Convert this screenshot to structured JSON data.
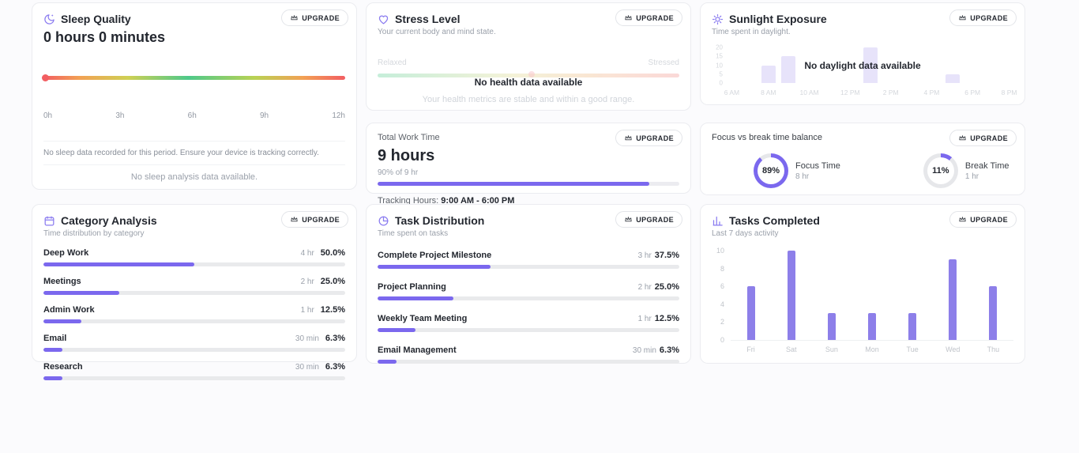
{
  "colors": {
    "accent": "#7b68ee",
    "track": "#e6e7ea"
  },
  "upgrade_label": "UPGRADE",
  "cards": {
    "sleep": {
      "title": "Sleep Quality",
      "value": "0 hours 0 minutes",
      "ticks": [
        "0h",
        "3h",
        "6h",
        "9h",
        "12h"
      ],
      "note": "No sleep data recorded for this period. Ensure your device is tracking correctly.",
      "empty": "No sleep analysis data available."
    },
    "stress": {
      "title": "Stress Level",
      "subtitle": "Your current body and mind state.",
      "scale_left": "Relaxed",
      "scale_right": "Stressed",
      "overlay_title": "No health data available",
      "overlay_subtitle": "Your health metrics are stable and within a good range."
    },
    "sunlight": {
      "title": "Sunlight Exposure",
      "subtitle": "Time spent in daylight.",
      "overlay_title": "No daylight data available"
    },
    "work": {
      "title": "Total Work Time",
      "value": "9 hours",
      "progress_caption": "90% of 9 hr",
      "progress_pct": 90,
      "tracking_label": "Tracking Hours:",
      "tracking_value": "9:00 AM - 6:00 PM"
    },
    "focus": {
      "title": "Focus vs break time balance",
      "donuts": [
        {
          "pct": 89,
          "pct_label": "89%",
          "label": "Focus Time",
          "sub": "8 hr"
        },
        {
          "pct": 11,
          "pct_label": "11%",
          "label": "Break Time",
          "sub": "1 hr"
        }
      ]
    },
    "category": {
      "title": "Category Analysis",
      "subtitle": "Time distribution by category",
      "rows": [
        {
          "label": "Deep Work",
          "time": "4 hr",
          "pct_label": "50.0%",
          "pct": 50
        },
        {
          "label": "Meetings",
          "time": "2 hr",
          "pct_label": "25.0%",
          "pct": 25
        },
        {
          "label": "Admin Work",
          "time": "1 hr",
          "pct_label": "12.5%",
          "pct": 12.5
        },
        {
          "label": "Email",
          "time": "30 min",
          "pct_label": "6.3%",
          "pct": 6.3
        },
        {
          "label": "Research",
          "time": "30 min",
          "pct_label": "6.3%",
          "pct": 6.3
        }
      ]
    },
    "tasks_dist": {
      "title": "Task Distribution",
      "subtitle": "Time spent on tasks",
      "rows": [
        {
          "label": "Complete Project Milestone",
          "time": "3 hr",
          "pct_label": "37.5%",
          "pct": 37.5
        },
        {
          "label": "Project Planning",
          "time": "2 hr",
          "pct_label": "25.0%",
          "pct": 25
        },
        {
          "label": "Weekly Team Meeting",
          "time": "1 hr",
          "pct_label": "12.5%",
          "pct": 12.5
        },
        {
          "label": "Email Management",
          "time": "30 min",
          "pct_label": "6.3%",
          "pct": 6.3
        }
      ]
    },
    "tasks_done": {
      "title": "Tasks Completed",
      "subtitle": "Last 7 days activity"
    }
  },
  "chart_data": [
    {
      "type": "bar",
      "title": "Sunlight Exposure",
      "ylim": [
        0,
        20
      ],
      "yticks": [
        "20",
        "15",
        "10",
        "5",
        "0"
      ],
      "ytick_pos": [
        0,
        25,
        50,
        75,
        100
      ],
      "xticks": [
        "6 AM",
        "8 AM",
        "10 AM",
        "12 PM",
        "2 PM",
        "4 PM",
        "6 PM",
        "8 PM"
      ],
      "xtick_pos": [
        1.5,
        14.3,
        28.6,
        42.9,
        57.1,
        71.4,
        85.7,
        98.5
      ],
      "bars": [
        {
          "x": "8 AM",
          "value": 10,
          "left_pct": 14.3,
          "height_pct": 50
        },
        {
          "x": "9 AM",
          "value": 15,
          "left_pct": 21.4,
          "height_pct": 75
        },
        {
          "x": "1 PM",
          "value": 20,
          "left_pct": 50,
          "height_pct": 100
        },
        {
          "x": "5 PM",
          "value": 5,
          "left_pct": 78.6,
          "height_pct": 25
        }
      ]
    },
    {
      "type": "bar",
      "title": "Tasks Completed",
      "categories": [
        "Fri",
        "Sat",
        "Sun",
        "Mon",
        "Tue",
        "Wed",
        "Thu"
      ],
      "values": [
        6,
        10,
        3,
        3,
        3,
        9,
        6
      ],
      "values_pct": [
        60,
        100,
        30,
        30,
        30,
        90,
        60
      ],
      "ylim": [
        0,
        10
      ],
      "yticks": [
        "10",
        "8",
        "6",
        "4",
        "2",
        "0"
      ],
      "ytick_pos": [
        0,
        20,
        40,
        60,
        80,
        100
      ]
    }
  ]
}
